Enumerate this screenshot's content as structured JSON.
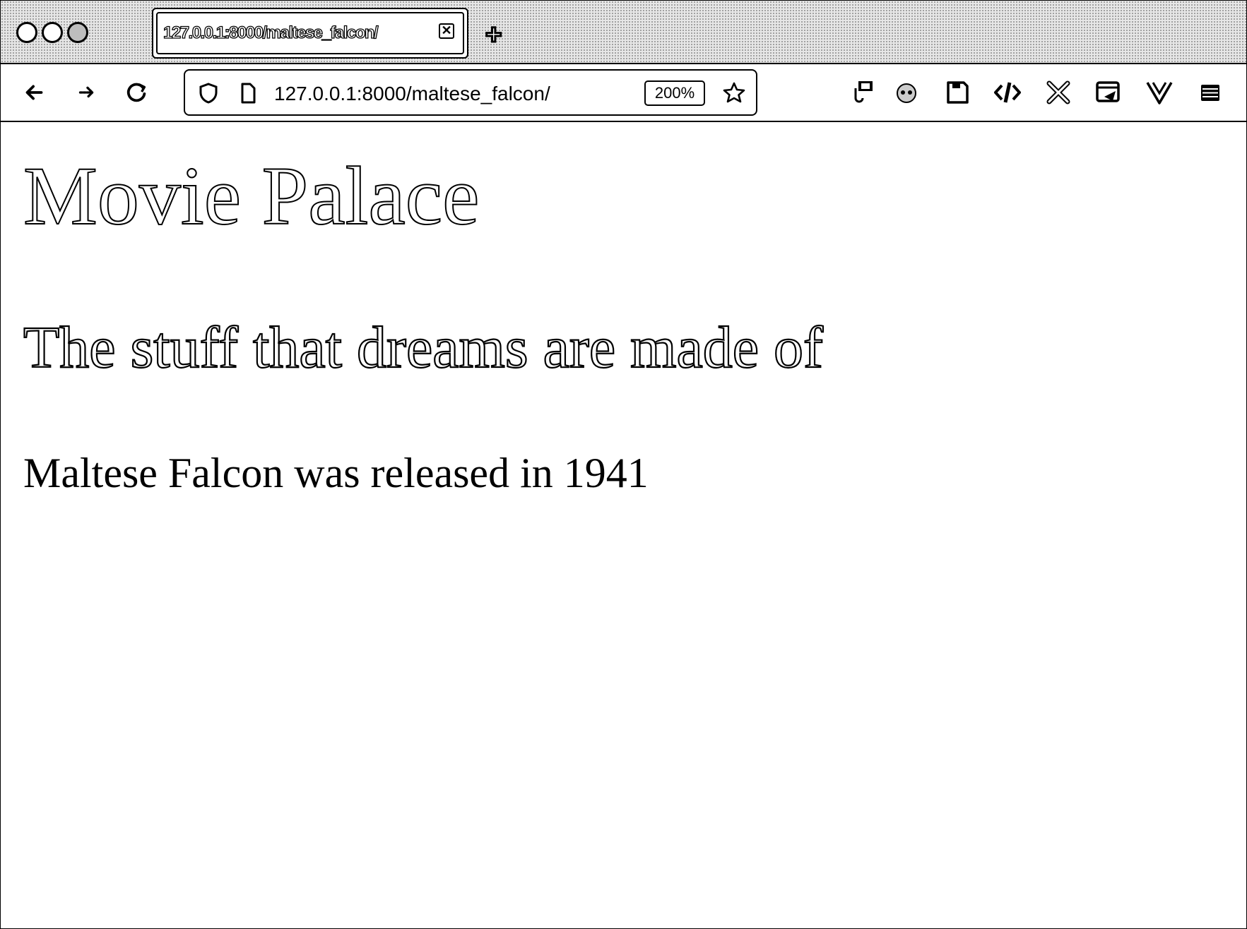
{
  "browser": {
    "tab": {
      "title": "127.0.0.1:8000/maltese_falcon/",
      "close_label": "✕"
    },
    "new_tab_label": "+",
    "address_bar": {
      "url": "127.0.0.1:8000/maltese_falcon/",
      "zoom": "200%"
    },
    "nav_icons": [
      "back-icon",
      "forward-icon",
      "reload-icon"
    ],
    "extension_icons": [
      "json-viewer-icon",
      "privacy-badger-icon",
      "save-icon",
      "code-icon",
      "crossed-tools-icon",
      "screenshot-icon",
      "vue-devtools-icon",
      "menu-icon"
    ]
  },
  "page": {
    "heading": "Movie Palace",
    "subheading": "The stuff that dreams are made of",
    "paragraph": "Maltese Falcon was released in 1941"
  }
}
